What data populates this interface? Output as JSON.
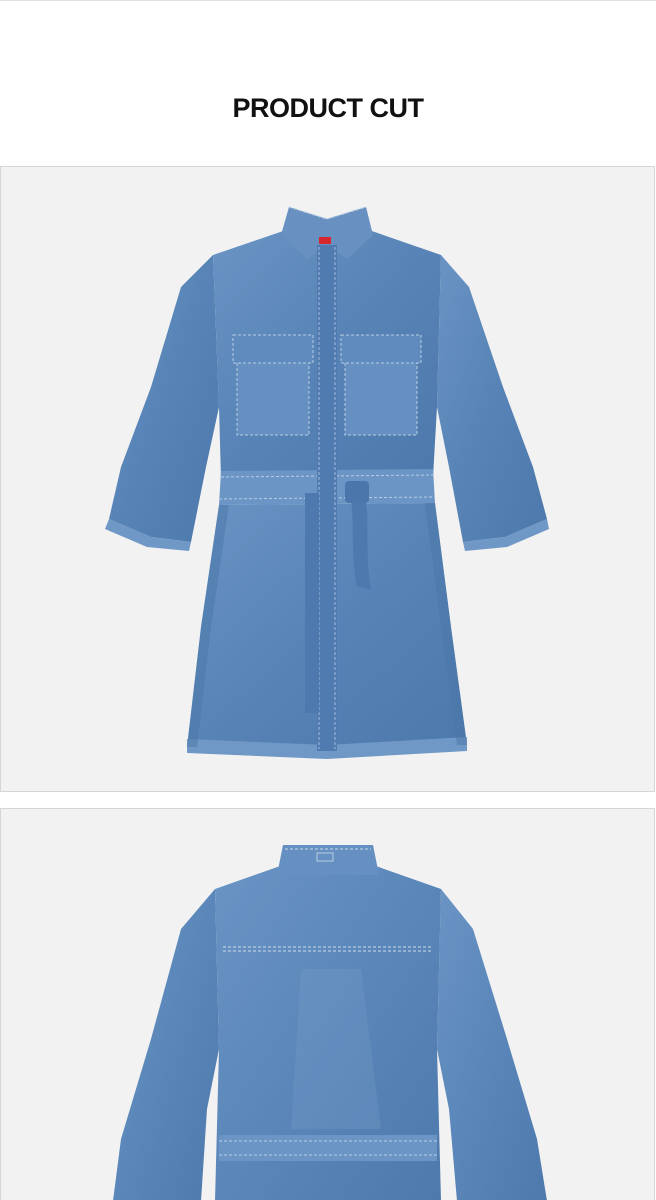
{
  "heading": {
    "text": "PRODUCT CUT"
  },
  "colors": {
    "panel_bg": "#f2f2f2",
    "denim": "#5b86b8",
    "denim_light": "#7ba2cc",
    "denim_dark": "#3e6a9c",
    "stitch": "#b7cce4",
    "tab_red": "#d7282f"
  },
  "images": [
    {
      "view": "front",
      "subject": "denim-shirt-dress"
    },
    {
      "view": "back",
      "subject": "denim-shirt-dress"
    }
  ]
}
